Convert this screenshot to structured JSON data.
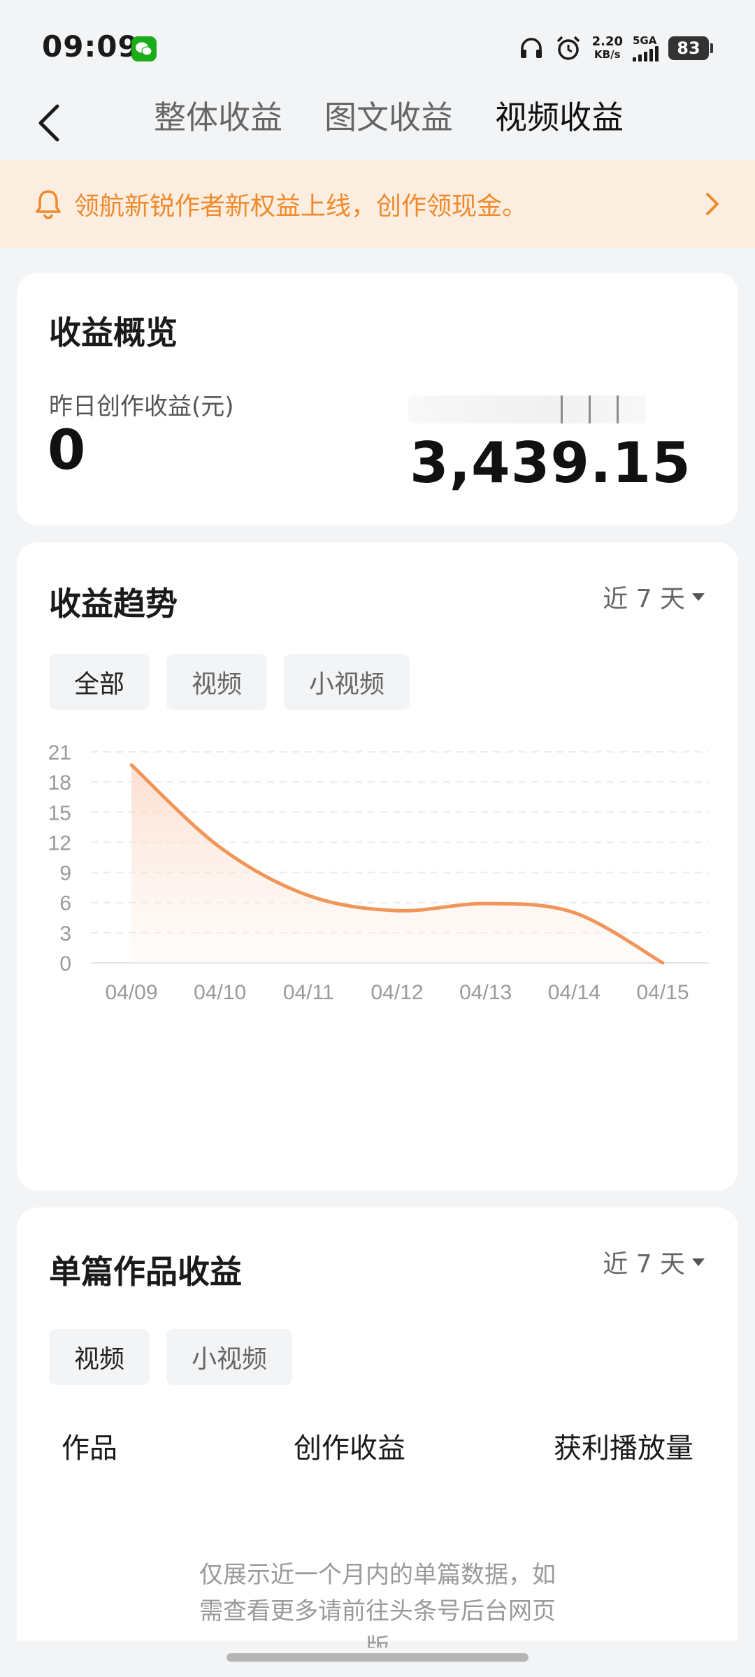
{
  "status_bar": {
    "time": "09:09",
    "net_speed": "2.20",
    "net_speed_unit": "KB/s",
    "signal_label": "5GA",
    "battery": "83",
    "icons": [
      "wechat-icon",
      "headphones-icon",
      "alarm-icon",
      "signal-icon",
      "battery-icon"
    ]
  },
  "header": {
    "tabs": [
      {
        "label": "整体收益",
        "active": false
      },
      {
        "label": "图文收益",
        "active": false
      },
      {
        "label": "视频收益",
        "active": true
      }
    ]
  },
  "banner": {
    "text": "领航新锐作者新权益上线，创作领现金。",
    "color": "#f08a2c"
  },
  "overview": {
    "title": "收益概览",
    "yesterday_label": "昨日创作收益(元)",
    "yesterday_value": "0",
    "total_value": "3,439.15"
  },
  "trend": {
    "title": "收益趋势",
    "range": "近 7 天",
    "filters": [
      {
        "label": "全部",
        "active": true
      },
      {
        "label": "视频",
        "active": false
      },
      {
        "label": "小视频",
        "active": false
      }
    ]
  },
  "chart_data": {
    "type": "area",
    "x": [
      "04/09",
      "04/10",
      "04/11",
      "04/12",
      "04/13",
      "04/14",
      "04/15"
    ],
    "series": [
      {
        "values": [
          19.7,
          11.5,
          6.7,
          5.2,
          5.9,
          5.0,
          0
        ]
      }
    ],
    "yticks": [
      0,
      3,
      6,
      9,
      12,
      15,
      18,
      21
    ],
    "ylim": [
      0,
      21
    ],
    "grid": true,
    "line_color": "#f0965a"
  },
  "works": {
    "title": "单篇作品收益",
    "range": "近 7 天",
    "filters": [
      {
        "label": "视频",
        "active": true
      },
      {
        "label": "小视频",
        "active": false
      }
    ],
    "columns": [
      "作品",
      "创作收益",
      "获利播放量"
    ],
    "hint_line1": "仅展示近一个月内的单篇数据，如",
    "hint_line2": "需查看更多请前往头条号后台网页",
    "hint_line3": "版"
  }
}
